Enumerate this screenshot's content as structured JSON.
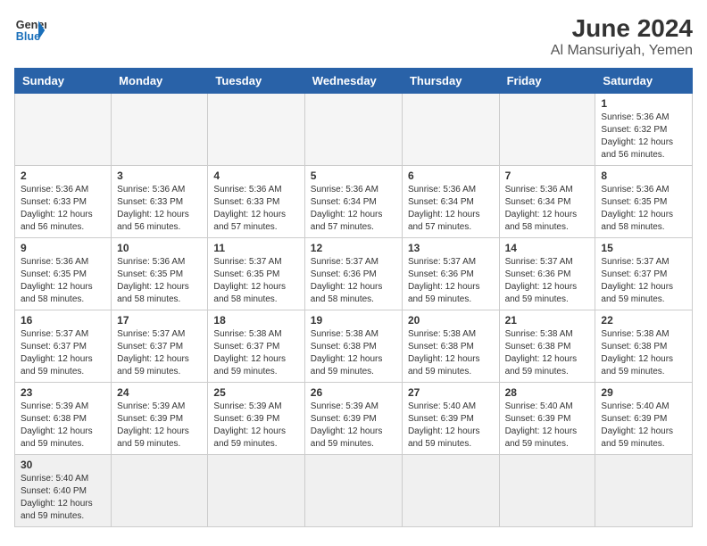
{
  "header": {
    "logo_general": "General",
    "logo_blue": "Blue",
    "month_year": "June 2024",
    "location": "Al Mansuriyah, Yemen"
  },
  "days_of_week": [
    "Sunday",
    "Monday",
    "Tuesday",
    "Wednesday",
    "Thursday",
    "Friday",
    "Saturday"
  ],
  "weeks": [
    [
      {
        "day": "",
        "info": ""
      },
      {
        "day": "",
        "info": ""
      },
      {
        "day": "",
        "info": ""
      },
      {
        "day": "",
        "info": ""
      },
      {
        "day": "",
        "info": ""
      },
      {
        "day": "",
        "info": ""
      },
      {
        "day": "1",
        "info": "Sunrise: 5:36 AM\nSunset: 6:32 PM\nDaylight: 12 hours and 56 minutes."
      }
    ],
    [
      {
        "day": "2",
        "info": "Sunrise: 5:36 AM\nSunset: 6:33 PM\nDaylight: 12 hours and 56 minutes."
      },
      {
        "day": "3",
        "info": "Sunrise: 5:36 AM\nSunset: 6:33 PM\nDaylight: 12 hours and 56 minutes."
      },
      {
        "day": "4",
        "info": "Sunrise: 5:36 AM\nSunset: 6:33 PM\nDaylight: 12 hours and 57 minutes."
      },
      {
        "day": "5",
        "info": "Sunrise: 5:36 AM\nSunset: 6:34 PM\nDaylight: 12 hours and 57 minutes."
      },
      {
        "day": "6",
        "info": "Sunrise: 5:36 AM\nSunset: 6:34 PM\nDaylight: 12 hours and 57 minutes."
      },
      {
        "day": "7",
        "info": "Sunrise: 5:36 AM\nSunset: 6:34 PM\nDaylight: 12 hours and 58 minutes."
      },
      {
        "day": "8",
        "info": "Sunrise: 5:36 AM\nSunset: 6:35 PM\nDaylight: 12 hours and 58 minutes."
      }
    ],
    [
      {
        "day": "9",
        "info": "Sunrise: 5:36 AM\nSunset: 6:35 PM\nDaylight: 12 hours and 58 minutes."
      },
      {
        "day": "10",
        "info": "Sunrise: 5:36 AM\nSunset: 6:35 PM\nDaylight: 12 hours and 58 minutes."
      },
      {
        "day": "11",
        "info": "Sunrise: 5:37 AM\nSunset: 6:35 PM\nDaylight: 12 hours and 58 minutes."
      },
      {
        "day": "12",
        "info": "Sunrise: 5:37 AM\nSunset: 6:36 PM\nDaylight: 12 hours and 58 minutes."
      },
      {
        "day": "13",
        "info": "Sunrise: 5:37 AM\nSunset: 6:36 PM\nDaylight: 12 hours and 59 minutes."
      },
      {
        "day": "14",
        "info": "Sunrise: 5:37 AM\nSunset: 6:36 PM\nDaylight: 12 hours and 59 minutes."
      },
      {
        "day": "15",
        "info": "Sunrise: 5:37 AM\nSunset: 6:37 PM\nDaylight: 12 hours and 59 minutes."
      }
    ],
    [
      {
        "day": "16",
        "info": "Sunrise: 5:37 AM\nSunset: 6:37 PM\nDaylight: 12 hours and 59 minutes."
      },
      {
        "day": "17",
        "info": "Sunrise: 5:37 AM\nSunset: 6:37 PM\nDaylight: 12 hours and 59 minutes."
      },
      {
        "day": "18",
        "info": "Sunrise: 5:38 AM\nSunset: 6:37 PM\nDaylight: 12 hours and 59 minutes."
      },
      {
        "day": "19",
        "info": "Sunrise: 5:38 AM\nSunset: 6:38 PM\nDaylight: 12 hours and 59 minutes."
      },
      {
        "day": "20",
        "info": "Sunrise: 5:38 AM\nSunset: 6:38 PM\nDaylight: 12 hours and 59 minutes."
      },
      {
        "day": "21",
        "info": "Sunrise: 5:38 AM\nSunset: 6:38 PM\nDaylight: 12 hours and 59 minutes."
      },
      {
        "day": "22",
        "info": "Sunrise: 5:38 AM\nSunset: 6:38 PM\nDaylight: 12 hours and 59 minutes."
      }
    ],
    [
      {
        "day": "23",
        "info": "Sunrise: 5:39 AM\nSunset: 6:38 PM\nDaylight: 12 hours and 59 minutes."
      },
      {
        "day": "24",
        "info": "Sunrise: 5:39 AM\nSunset: 6:39 PM\nDaylight: 12 hours and 59 minutes."
      },
      {
        "day": "25",
        "info": "Sunrise: 5:39 AM\nSunset: 6:39 PM\nDaylight: 12 hours and 59 minutes."
      },
      {
        "day": "26",
        "info": "Sunrise: 5:39 AM\nSunset: 6:39 PM\nDaylight: 12 hours and 59 minutes."
      },
      {
        "day": "27",
        "info": "Sunrise: 5:40 AM\nSunset: 6:39 PM\nDaylight: 12 hours and 59 minutes."
      },
      {
        "day": "28",
        "info": "Sunrise: 5:40 AM\nSunset: 6:39 PM\nDaylight: 12 hours and 59 minutes."
      },
      {
        "day": "29",
        "info": "Sunrise: 5:40 AM\nSunset: 6:39 PM\nDaylight: 12 hours and 59 minutes."
      }
    ],
    [
      {
        "day": "30",
        "info": "Sunrise: 5:40 AM\nSunset: 6:40 PM\nDaylight: 12 hours and 59 minutes."
      },
      {
        "day": "",
        "info": ""
      },
      {
        "day": "",
        "info": ""
      },
      {
        "day": "",
        "info": ""
      },
      {
        "day": "",
        "info": ""
      },
      {
        "day": "",
        "info": ""
      },
      {
        "day": "",
        "info": ""
      }
    ]
  ]
}
